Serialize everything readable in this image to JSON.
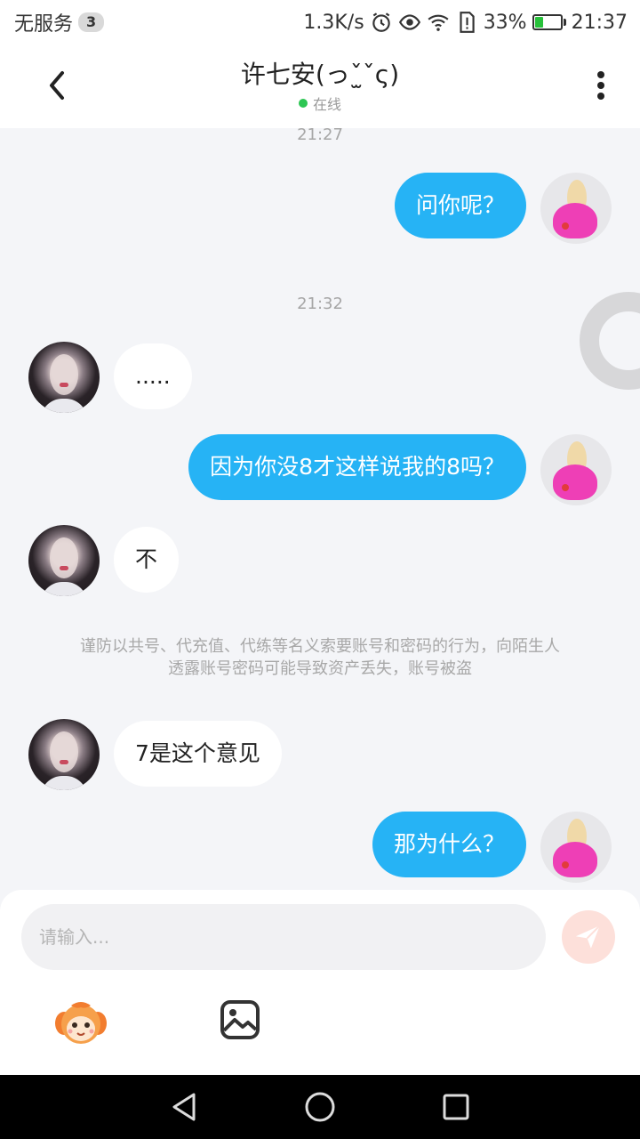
{
  "status_bar": {
    "carrier": "无服务",
    "notification_count": "3",
    "net_speed": "1.3K/s",
    "battery_percent": "33%",
    "battery_level": 0.33,
    "time": "21:37",
    "icons": [
      "alarm-icon",
      "eye-icon",
      "wifi-icon",
      "sim-alert-icon",
      "battery-icon"
    ]
  },
  "header": {
    "title": "许七安(っˇ̫ˇς)",
    "status": "在线",
    "status_color": "#2dc653"
  },
  "chat": {
    "timestamps": [
      "21:27",
      "21:32"
    ],
    "messages": [
      {
        "side": "out",
        "text": "问你呢？"
      },
      {
        "side": "in",
        "text": "....."
      },
      {
        "side": "out",
        "text": "因为你没8才这样说我的8吗？"
      },
      {
        "side": "in",
        "text": "不"
      },
      {
        "side": "in",
        "text": "7是这个意见"
      },
      {
        "side": "out",
        "text": "那为什么？"
      }
    ],
    "warning_line1": "谨防以共号、代充值、代练等名义索要账号和密码的行为，向陌生人",
    "warning_line2": "透露账号密码可能导致资产丢失，账号被盗"
  },
  "input": {
    "placeholder": "请输入..."
  },
  "colors": {
    "outgoing_bubble": "#26b3f5",
    "incoming_bubble": "#ffffff",
    "send_button": "#fde0da",
    "background": "#f4f5f8"
  },
  "toolbar_icons": [
    "emoji-icon",
    "image-icon"
  ],
  "nav_icons": [
    "back-triangle-icon",
    "home-circle-icon",
    "recents-square-icon"
  ]
}
